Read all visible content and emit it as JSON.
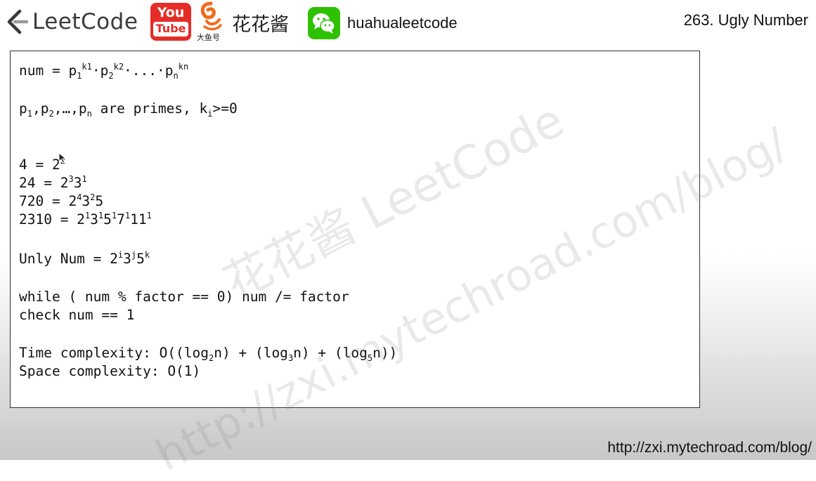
{
  "header": {
    "brand": "LeetCode",
    "youtube_top": "You",
    "youtube_bottom": "Tube",
    "dayu_label": "大鱼号",
    "channel_name": "花花酱",
    "wechat_id": "huahualeetcode",
    "problem_title": "263. Ugly Number"
  },
  "lines": {
    "l1": {
      "lhs": "num = p",
      "s1": "1",
      "e1": "k1",
      "d1": "·p",
      "s2": "2",
      "e2": "k2",
      "d2": "·...·p",
      "s3": "n",
      "e3": "kn"
    },
    "l2": {
      "p": "p",
      "s1": "1",
      "c1": ",p",
      "s2": "2",
      "c2": ",…,p",
      "s3": "n",
      "mid": " are primes, k",
      "s4": "i",
      "end": ">=0"
    },
    "l3": {
      "lhs": "4 = 2",
      "e1": "2"
    },
    "l4": {
      "lhs": "24 = 2",
      "e1": "3",
      "b2": "3",
      "e2": "1"
    },
    "l5": {
      "lhs": "720 = 2",
      "e1": "4",
      "b2": "3",
      "e2": "2",
      "tail": "5"
    },
    "l6": {
      "lhs": "2310 = 2",
      "e1": "1",
      "b2": "3",
      "e2": "1",
      "b3": "5",
      "e3": "1",
      "b4": "7",
      "e4": "1",
      "b5": "11",
      "e5": "1"
    },
    "l7": {
      "lhs": "Unly Num = 2",
      "e1": "i",
      "b2": "3",
      "e2": "j",
      "b3": "5",
      "e3": "k"
    },
    "l8": "while ( num % factor == 0) num /= factor",
    "l9": "check num == 1",
    "l10": {
      "a": "Time complexity: O((log",
      "s1": "2",
      "b": "n) + (log",
      "s2": "3",
      "c": "n) + (log",
      "s3": "5",
      "d": "n))"
    },
    "l11": "Space complexity: O(1)"
  },
  "watermark": {
    "main": "花花酱 LeetCode",
    "url": "http://zxi.mytechroad.com/blog/"
  },
  "footer": {
    "url": "http://zxi.mytechroad.com/blog/"
  },
  "colors": {
    "youtube_red": "#e52d27",
    "wechat_green": "#2dc100",
    "dayu_orange": "#f26b1d"
  }
}
